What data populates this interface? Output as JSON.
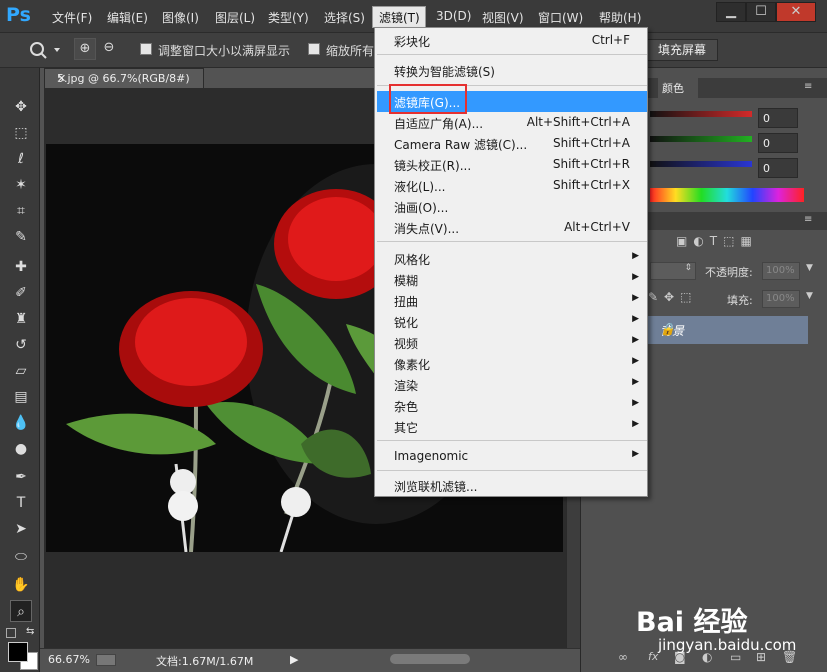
{
  "app": {
    "logo": "Ps"
  },
  "menubar": {
    "items": [
      "文件(F)",
      "编辑(E)",
      "图像(I)",
      "图层(L)",
      "类型(Y)",
      "选择(S)",
      "滤镜(T)",
      "3D(D)",
      "视图(V)",
      "窗口(W)",
      "帮助(H)"
    ],
    "active": "滤镜(T)"
  },
  "window_controls": {
    "minimize": "▁",
    "restore": "☐",
    "close": "✕"
  },
  "options": {
    "resize_windows": "调整窗口大小以满屏显示",
    "zoom_all": "缩放所有",
    "fill_screen": "填充屏幕"
  },
  "document": {
    "tab_title": "5.jpg @ 66.7%(RGB/8#)",
    "zoom": "66.67%",
    "doc_info": "文档:1.67M/1.67M"
  },
  "color_panel": {
    "tab": "颜色",
    "r": "0",
    "g": "0",
    "b": "0",
    "colors": {
      "red": "#d42a2a",
      "green": "#22b022",
      "blue": "#2a36d4"
    }
  },
  "layers_panel": {
    "opacity_label": "不透明度:",
    "opacity_value": "100%",
    "fill_label": "填充:",
    "fill_value": "100%",
    "layer_name": "背景"
  },
  "filter_menu": {
    "items": [
      {
        "label": "彩块化",
        "shortcut": "Ctrl+F"
      },
      {
        "label": "转换为智能滤镜(S)",
        "shortcut": ""
      },
      {
        "label": "滤镜库(G)...",
        "shortcut": "",
        "selected": true
      },
      {
        "label": "自适应广角(A)...",
        "shortcut": "Alt+Shift+Ctrl+A"
      },
      {
        "label": "Camera Raw 滤镜(C)...",
        "shortcut": "Shift+Ctrl+A"
      },
      {
        "label": "镜头校正(R)...",
        "shortcut": "Shift+Ctrl+R"
      },
      {
        "label": "液化(L)...",
        "shortcut": "Shift+Ctrl+X"
      },
      {
        "label": "油画(O)...",
        "shortcut": ""
      },
      {
        "label": "消失点(V)...",
        "shortcut": "Alt+Ctrl+V"
      },
      {
        "label": "风格化",
        "submenu": true
      },
      {
        "label": "模糊",
        "submenu": true
      },
      {
        "label": "扭曲",
        "submenu": true
      },
      {
        "label": "锐化",
        "submenu": true
      },
      {
        "label": "视频",
        "submenu": true
      },
      {
        "label": "像素化",
        "submenu": true
      },
      {
        "label": "渲染",
        "submenu": true
      },
      {
        "label": "杂色",
        "submenu": true
      },
      {
        "label": "其它",
        "submenu": true
      },
      {
        "label": "Imagenomic",
        "submenu": true
      },
      {
        "label": "浏览联机滤镜...",
        "shortcut": ""
      }
    ],
    "highlight_color": "#e53030",
    "selection_color": "#3399ff"
  },
  "watermark": {
    "main": "Bai 经验",
    "sub": "jingyan.baidu.com"
  }
}
